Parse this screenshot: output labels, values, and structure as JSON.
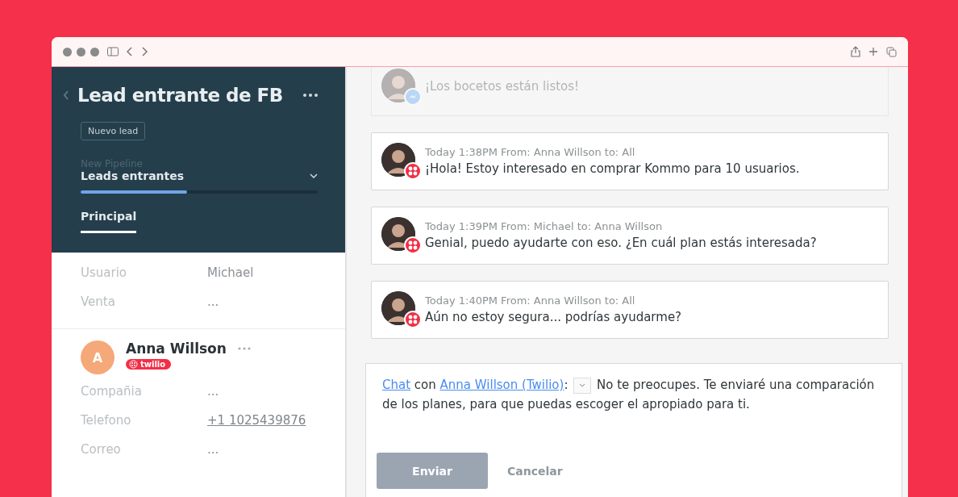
{
  "lead": {
    "title": "Lead entrante de FB",
    "status": "Nuevo lead",
    "pipeline_label": "New Pipeline",
    "pipeline": "Leads entrantes",
    "level": 0.45,
    "tabs": [
      {
        "label": "Principal",
        "selected": true
      }
    ]
  },
  "fields": [
    {
      "label": "Usuario",
      "value": "Michael",
      "kind": "text"
    },
    {
      "label": "Venta",
      "value": "...",
      "kind": "text"
    }
  ],
  "contact": {
    "initial": "A",
    "name": "Anna Willson",
    "channel": "twilio",
    "fields": [
      {
        "label": "Compañia",
        "value": "...",
        "kind": "text"
      },
      {
        "label": "Telefono",
        "value": "+1 1025439876",
        "kind": "link"
      },
      {
        "label": "Correo",
        "value": "...",
        "kind": "text"
      }
    ]
  },
  "messages": [
    {
      "faded": true,
      "kind": "messenger",
      "text": "¡Los bocetos están listos!"
    },
    {
      "faded": false,
      "kind": "twilio",
      "meta": "Today 1:38PM From: Anna Willson to: All",
      "text": "¡Hola! Estoy interesado en comprar Kommo para 10 usuarios."
    },
    {
      "faded": false,
      "kind": "twilio",
      "meta": "Today 1:39PM From: Michael to: Anna Willson",
      "text": "Genial, puedo ayudarte con eso. ¿En cuál plan estás interesada?"
    },
    {
      "faded": false,
      "kind": "twilio",
      "meta": "Today 1:40PM From: Anna Willson to: All",
      "text": "Aún no estoy segura... podrías ayudarme?"
    }
  ],
  "reply": {
    "chat_link": "Chat",
    "connector": "con",
    "contact_link": "Anna Willson (Twilio)",
    "separator": ":",
    "text": "No te preocupes. Te enviaré una comparación de los planes, para que puedas escoger el apropiado para ti.",
    "send": "Enviar",
    "cancel": "Cancelar"
  }
}
